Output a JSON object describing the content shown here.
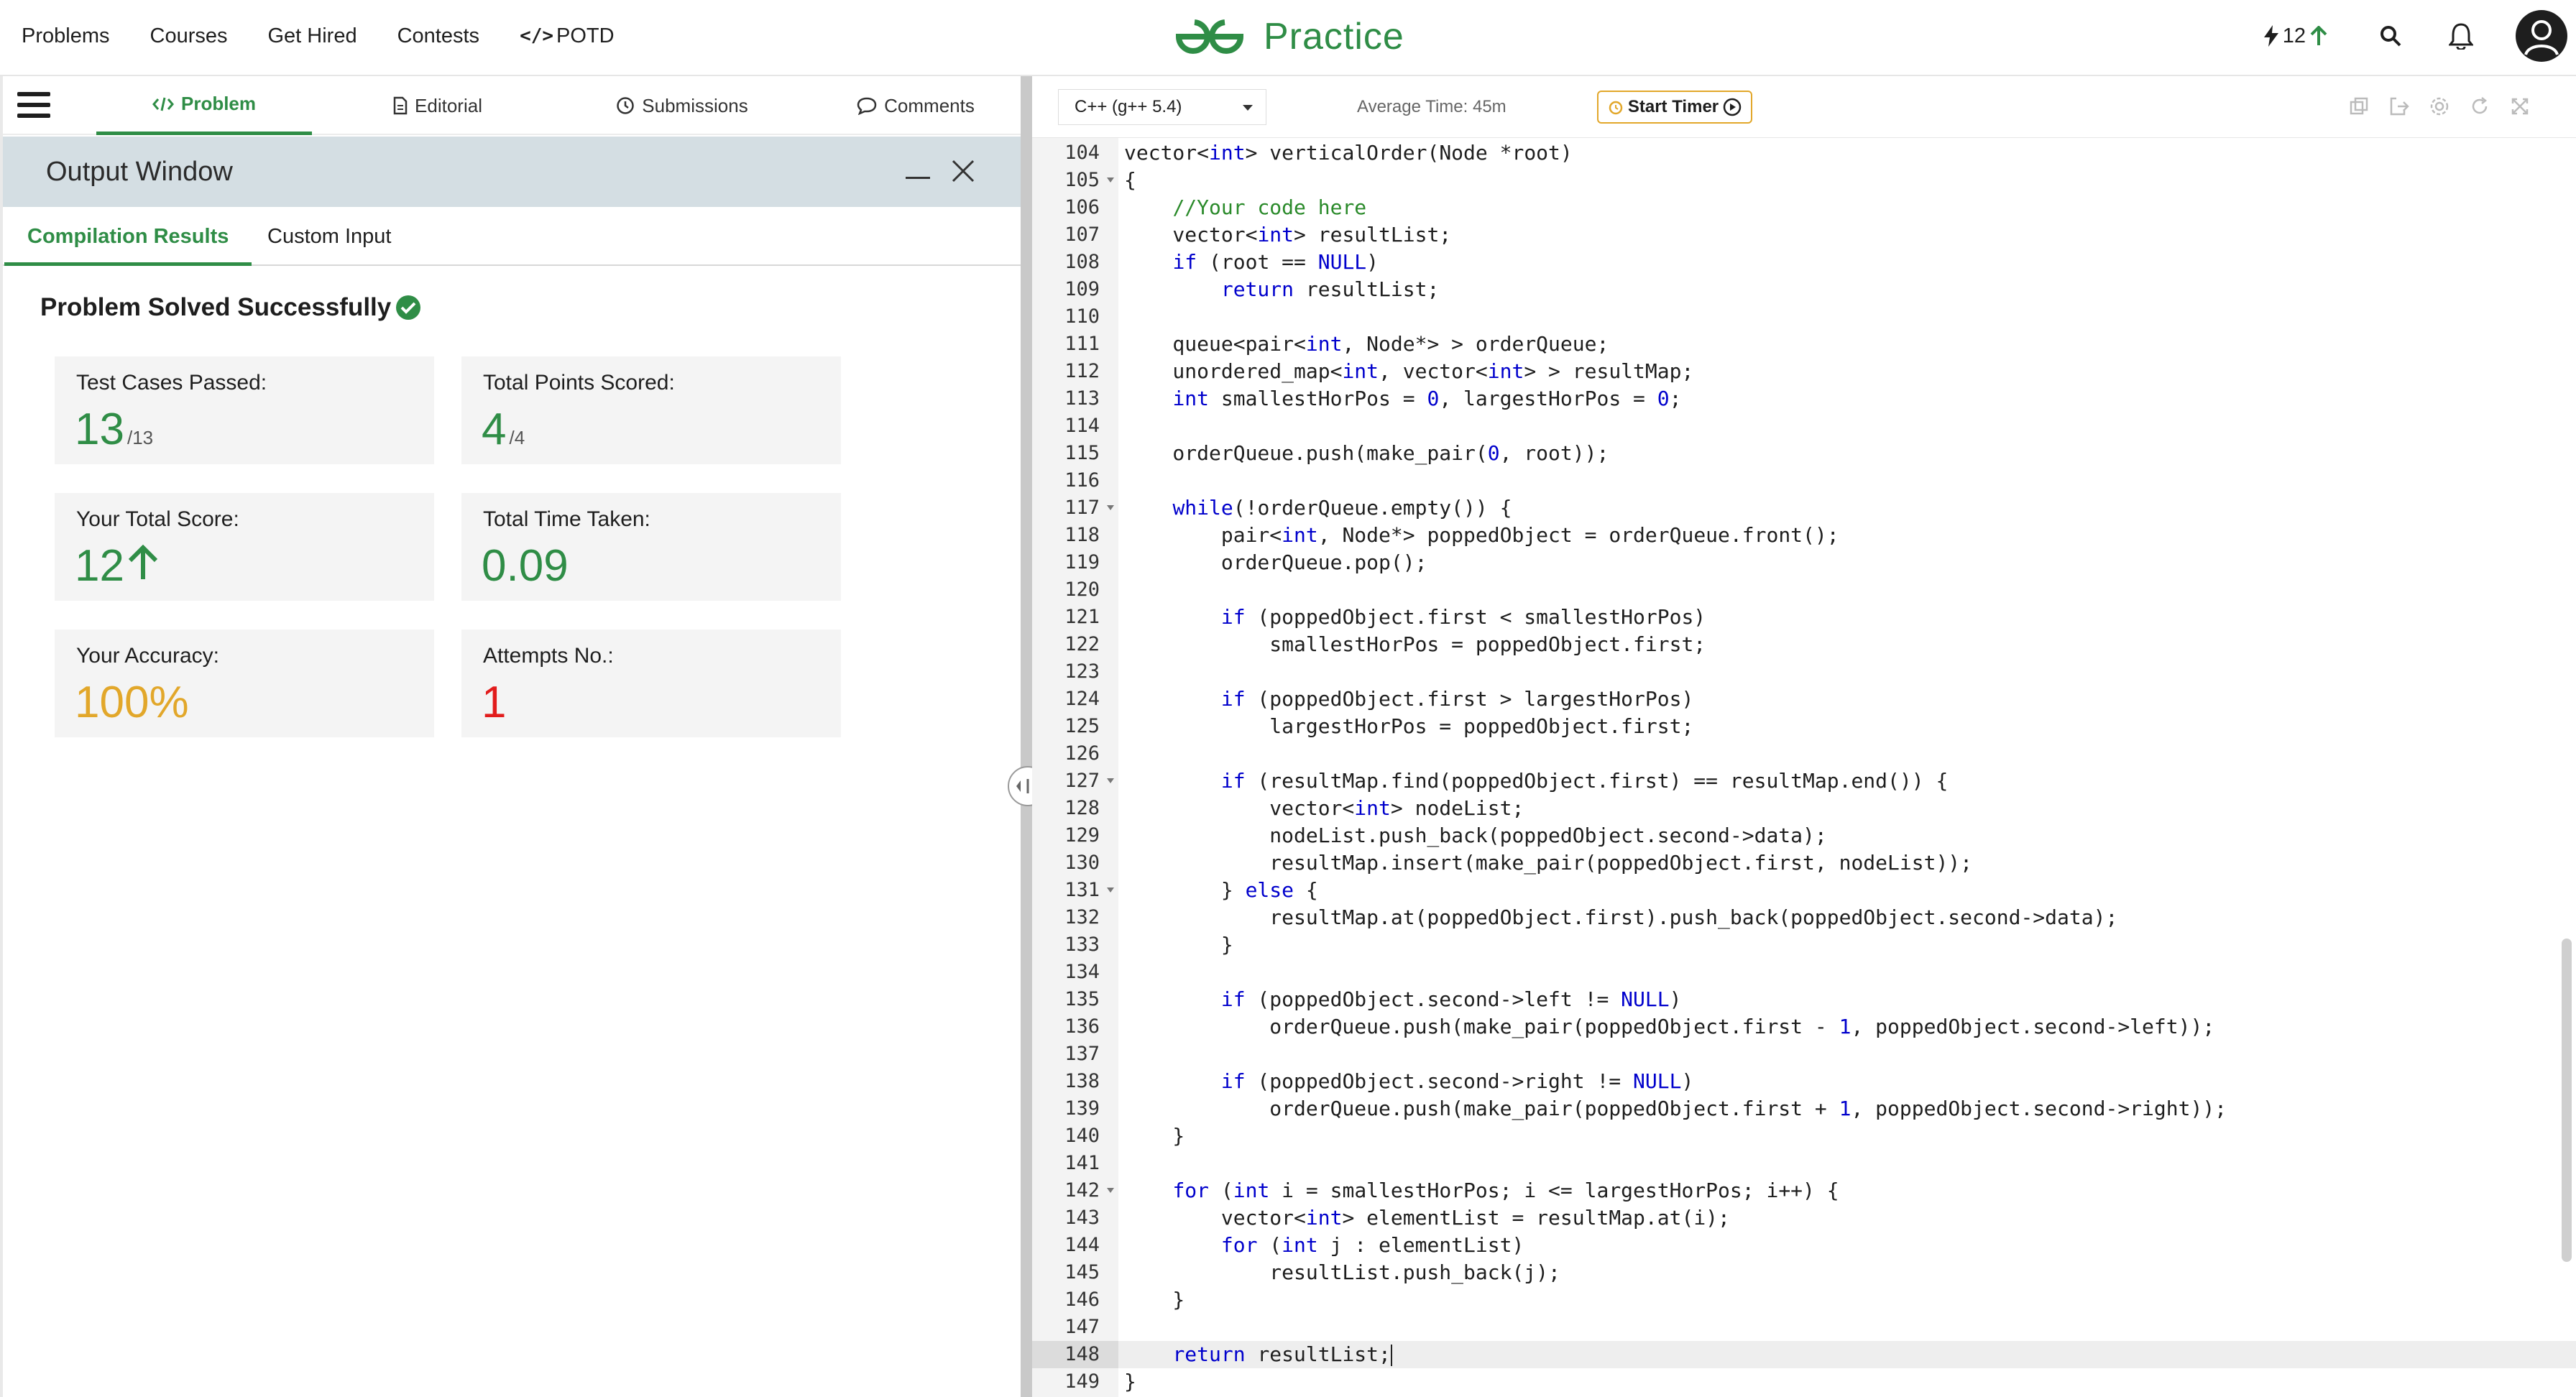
{
  "nav": {
    "links": [
      "Problems",
      "Courses",
      "Get Hired",
      "Contests",
      "POTD"
    ],
    "brand": "Practice",
    "streak": "12"
  },
  "problem_tabs": [
    "Problem",
    "Editorial",
    "Submissions",
    "Comments"
  ],
  "output": {
    "title": "Output Window",
    "subtabs": [
      "Compilation Results",
      "Custom Input"
    ],
    "status": "Problem Solved Successfully",
    "cards": [
      {
        "label": "Test Cases Passed:",
        "value": "13",
        "sub": "/13",
        "color": "#2f8d46"
      },
      {
        "label": "Total Points Scored:",
        "value": "4",
        "sub": "/4",
        "color": "#2f8d46"
      },
      {
        "label": "Your Total Score:",
        "value": "12",
        "sub": "",
        "color": "#2f8d46"
      },
      {
        "label": "Total Time Taken:",
        "value": "0.09",
        "sub": "",
        "color": "#2f8d46"
      },
      {
        "label": "Your Accuracy:",
        "value": "100%",
        "sub": "",
        "color": "#e2a72a"
      },
      {
        "label": "Attempts No.:",
        "value": "1",
        "sub": "",
        "color": "#e21c1c"
      }
    ]
  },
  "editor": {
    "language": "C++ (g++ 5.4)",
    "average_time": "Average Time: 45m",
    "timer_label": "Start Timer",
    "lines": [
      {
        "n": "104",
        "fold": false,
        "code": "vector<int> verticalOrder(Node *root)"
      },
      {
        "n": "105",
        "fold": true,
        "code": "{"
      },
      {
        "n": "106",
        "fold": false,
        "code": "    //Your code here"
      },
      {
        "n": "107",
        "fold": false,
        "code": "    vector<int> resultList;"
      },
      {
        "n": "108",
        "fold": false,
        "code": "    if (root == NULL)"
      },
      {
        "n": "109",
        "fold": false,
        "code": "        return resultList;"
      },
      {
        "n": "110",
        "fold": false,
        "code": ""
      },
      {
        "n": "111",
        "fold": false,
        "code": "    queue<pair<int, Node*> > orderQueue;"
      },
      {
        "n": "112",
        "fold": false,
        "code": "    unordered_map<int, vector<int> > resultMap;"
      },
      {
        "n": "113",
        "fold": false,
        "code": "    int smallestHorPos = 0, largestHorPos = 0;"
      },
      {
        "n": "114",
        "fold": false,
        "code": ""
      },
      {
        "n": "115",
        "fold": false,
        "code": "    orderQueue.push(make_pair(0, root));"
      },
      {
        "n": "116",
        "fold": false,
        "code": ""
      },
      {
        "n": "117",
        "fold": true,
        "code": "    while(!orderQueue.empty()) {"
      },
      {
        "n": "118",
        "fold": false,
        "code": "        pair<int, Node*> poppedObject = orderQueue.front();"
      },
      {
        "n": "119",
        "fold": false,
        "code": "        orderQueue.pop();"
      },
      {
        "n": "120",
        "fold": false,
        "code": ""
      },
      {
        "n": "121",
        "fold": false,
        "code": "        if (poppedObject.first < smallestHorPos)"
      },
      {
        "n": "122",
        "fold": false,
        "code": "            smallestHorPos = poppedObject.first;"
      },
      {
        "n": "123",
        "fold": false,
        "code": ""
      },
      {
        "n": "124",
        "fold": false,
        "code": "        if (poppedObject.first > largestHorPos)"
      },
      {
        "n": "125",
        "fold": false,
        "code": "            largestHorPos = poppedObject.first;"
      },
      {
        "n": "126",
        "fold": false,
        "code": ""
      },
      {
        "n": "127",
        "fold": true,
        "code": "        if (resultMap.find(poppedObject.first) == resultMap.end()) {"
      },
      {
        "n": "128",
        "fold": false,
        "code": "            vector<int> nodeList;"
      },
      {
        "n": "129",
        "fold": false,
        "code": "            nodeList.push_back(poppedObject.second->data);"
      },
      {
        "n": "130",
        "fold": false,
        "code": "            resultMap.insert(make_pair(poppedObject.first, nodeList));"
      },
      {
        "n": "131",
        "fold": true,
        "code": "        } else {"
      },
      {
        "n": "132",
        "fold": false,
        "code": "            resultMap.at(poppedObject.first).push_back(poppedObject.second->data);"
      },
      {
        "n": "133",
        "fold": false,
        "code": "        }"
      },
      {
        "n": "134",
        "fold": false,
        "code": ""
      },
      {
        "n": "135",
        "fold": false,
        "code": "        if (poppedObject.second->left != NULL)"
      },
      {
        "n": "136",
        "fold": false,
        "code": "            orderQueue.push(make_pair(poppedObject.first - 1, poppedObject.second->left));"
      },
      {
        "n": "137",
        "fold": false,
        "code": ""
      },
      {
        "n": "138",
        "fold": false,
        "code": "        if (poppedObject.second->right != NULL)"
      },
      {
        "n": "139",
        "fold": false,
        "code": "            orderQueue.push(make_pair(poppedObject.first + 1, poppedObject.second->right));"
      },
      {
        "n": "140",
        "fold": false,
        "code": "    }"
      },
      {
        "n": "141",
        "fold": false,
        "code": ""
      },
      {
        "n": "142",
        "fold": true,
        "code": "    for (int i = smallestHorPos; i <= largestHorPos; i++) {"
      },
      {
        "n": "143",
        "fold": false,
        "code": "        vector<int> elementList = resultMap.at(i);"
      },
      {
        "n": "144",
        "fold": false,
        "code": "        for (int j : elementList)"
      },
      {
        "n": "145",
        "fold": false,
        "code": "            resultList.push_back(j);"
      },
      {
        "n": "146",
        "fold": false,
        "code": "    }"
      },
      {
        "n": "147",
        "fold": false,
        "code": ""
      },
      {
        "n": "148",
        "fold": false,
        "code": "    return resultList;",
        "active": true
      },
      {
        "n": "149",
        "fold": false,
        "code": "}"
      }
    ]
  },
  "colors": {
    "brand_green": "#2f8d46",
    "accuracy_orange": "#e2a72a",
    "attempts_red": "#e21c1c",
    "keyword_blue": "#0000cc",
    "comment_green": "#2a8a2a"
  },
  "icons": [
    "bolt-icon",
    "arrow-up-icon",
    "search-icon",
    "bell-icon",
    "user-avatar-icon",
    "hamburger-icon",
    "code-icon",
    "document-icon",
    "clock-icon",
    "comment-icon",
    "minimize-icon",
    "close-icon",
    "check-circle-icon",
    "split-handle-icon",
    "alarm-icon",
    "play-icon",
    "copy-icon",
    "export-icon",
    "settings-icon",
    "reset-icon",
    "fullscreen-icon"
  ]
}
